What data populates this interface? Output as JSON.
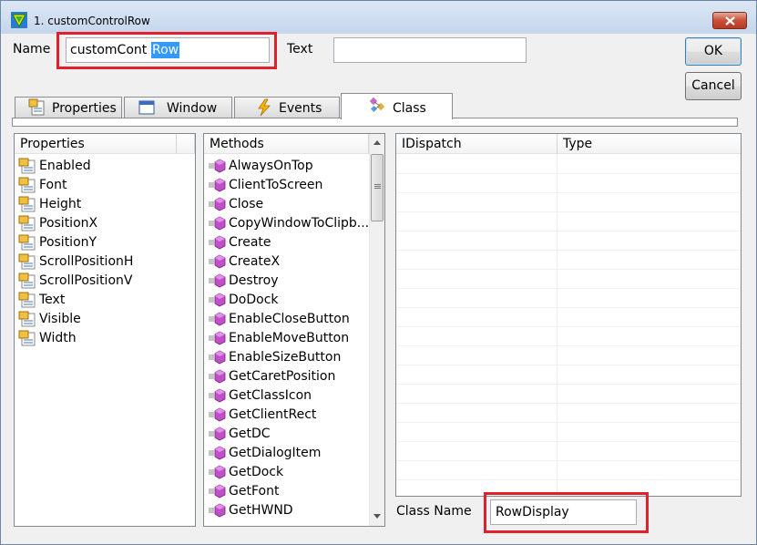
{
  "window": {
    "title": "1. customControlRow"
  },
  "name_field": {
    "label": "Name",
    "prefix": "customCont",
    "selected": "Row"
  },
  "text_field": {
    "label": "Text",
    "value": ""
  },
  "buttons": {
    "ok": "OK",
    "cancel": "Cancel"
  },
  "tabs": [
    {
      "label": "Properties",
      "icon": "properties-icon"
    },
    {
      "label": "Window",
      "icon": "window-icon"
    },
    {
      "label": "Events",
      "icon": "lightning-icon"
    },
    {
      "label": "Class",
      "icon": "class-icon",
      "active": true
    }
  ],
  "properties": {
    "header": "Properties",
    "items": [
      "Enabled",
      "Font",
      "Height",
      "PositionX",
      "PositionY",
      "ScrollPositionH",
      "ScrollPositionV",
      "Text",
      "Visible",
      "Width"
    ]
  },
  "methods": {
    "header": "Methods",
    "items": [
      "AlwaysOnTop",
      "ClientToScreen",
      "Close",
      "CopyWindowToClipb...",
      "Create",
      "CreateX",
      "Destroy",
      "DoDock",
      "EnableCloseButton",
      "EnableMoveButton",
      "EnableSizeButton",
      "GetCaretPosition",
      "GetClassIcon",
      "GetClientRect",
      "GetDC",
      "GetDialogItem",
      "GetDock",
      "GetFont",
      "GetHWND"
    ]
  },
  "interfaces": {
    "col1": "IDispatch",
    "col2": "Type"
  },
  "class_name": {
    "label": "Class Name",
    "value": "RowDisplay"
  },
  "colors": {
    "highlight": "#e0202a",
    "selection": "#3399ff"
  }
}
